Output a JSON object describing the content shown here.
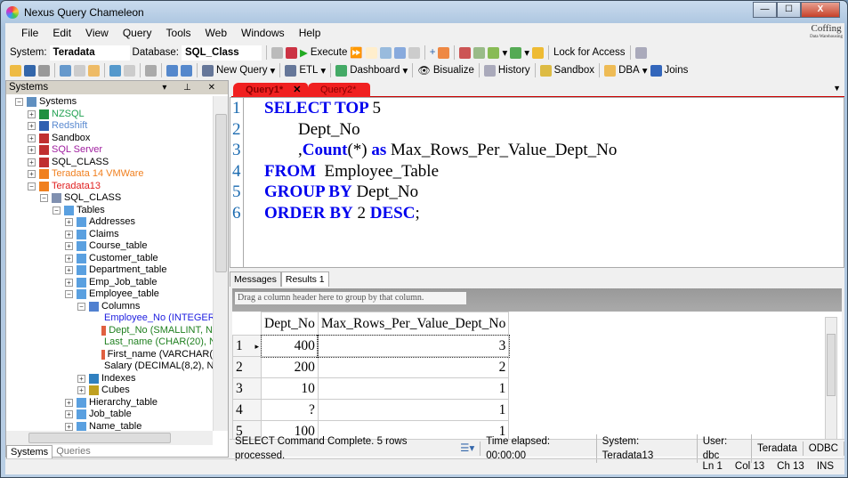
{
  "window": {
    "title": "Nexus Query Chameleon",
    "minimize": "—",
    "maximize": "☐",
    "close": "X",
    "brand": "Coffing",
    "brand_sub": "Data Warehousing"
  },
  "menu": [
    "File",
    "Edit",
    "View",
    "Query",
    "Tools",
    "Web",
    "Windows",
    "Help"
  ],
  "toolbar1": {
    "system_label": "System:",
    "system_value": "Teradata",
    "database_label": "Database:",
    "database_value": "SQL_Class",
    "execute": "Execute",
    "lock": "Lock for Access"
  },
  "toolbar2": {
    "new_query": "New Query",
    "etl": "ETL",
    "dashboard": "Dashboard",
    "bisualize": "Bisualize",
    "history": "History",
    "sandbox": "Sandbox",
    "dba": "DBA",
    "joins": "Joins"
  },
  "left_panel": {
    "title": "Systems",
    "tabs": [
      "Systems",
      "Queries"
    ],
    "tree": [
      {
        "label": "Systems",
        "depth": 0,
        "exp": "−",
        "color": "#000000",
        "icon": "servers-icon"
      },
      {
        "label": "NZSQL",
        "depth": 1,
        "exp": "+",
        "color": "#20a050",
        "icon": "nzsql-icon"
      },
      {
        "label": "Redshift",
        "depth": 1,
        "exp": "+",
        "color": "#5a8ad0",
        "icon": "redshift-icon"
      },
      {
        "label": "Sandbox",
        "depth": 1,
        "exp": "+",
        "color": "#000000",
        "icon": "sql-icon"
      },
      {
        "label": "SQL Server",
        "depth": 1,
        "exp": "+",
        "color": "#a020a0",
        "icon": "sql-icon"
      },
      {
        "label": "SQL_CLASS",
        "depth": 1,
        "exp": "+",
        "color": "#000000",
        "icon": "sql-icon"
      },
      {
        "label": "Teradata 14 VMWare",
        "depth": 1,
        "exp": "+",
        "color": "#f08020",
        "icon": "teradata-icon"
      },
      {
        "label": "Teradata13",
        "depth": 1,
        "exp": "−",
        "color": "#e02020",
        "icon": "teradata-icon"
      },
      {
        "label": "SQL_CLASS",
        "depth": 2,
        "exp": "−",
        "color": "#000000",
        "icon": "database-icon"
      },
      {
        "label": "Tables",
        "depth": 3,
        "exp": "−",
        "color": "#000000",
        "icon": "table-icon"
      },
      {
        "label": "Addresses",
        "depth": 4,
        "exp": "+",
        "color": "#000000",
        "icon": "table-icon"
      },
      {
        "label": "Claims",
        "depth": 4,
        "exp": "+",
        "color": "#000000",
        "icon": "table-icon"
      },
      {
        "label": "Course_table",
        "depth": 4,
        "exp": "+",
        "color": "#000000",
        "icon": "table-icon"
      },
      {
        "label": "Customer_table",
        "depth": 4,
        "exp": "+",
        "color": "#000000",
        "icon": "table-icon"
      },
      {
        "label": "Department_table",
        "depth": 4,
        "exp": "+",
        "color": "#000000",
        "icon": "table-icon"
      },
      {
        "label": "Emp_Job_table",
        "depth": 4,
        "exp": "+",
        "color": "#000000",
        "icon": "table-icon"
      },
      {
        "label": "Employee_table",
        "depth": 4,
        "exp": "−",
        "color": "#000000",
        "icon": "table-icon"
      },
      {
        "label": "Columns",
        "depth": 5,
        "exp": "−",
        "color": "#000000",
        "icon": "columns-icon"
      },
      {
        "label": "Employee_No (INTEGER",
        "depth": 6,
        "exp": "",
        "color": "#2020e0",
        "icon": "column-icon"
      },
      {
        "label": "Dept_No (SMALLINT, N",
        "depth": 6,
        "exp": "",
        "color": "#208020",
        "icon": "column-icon"
      },
      {
        "label": "Last_name (CHAR(20), N",
        "depth": 6,
        "exp": "",
        "color": "#208020",
        "icon": "column-icon"
      },
      {
        "label": "First_name (VARCHAR(",
        "depth": 6,
        "exp": "",
        "color": "#000000",
        "icon": "column-icon"
      },
      {
        "label": "Salary (DECIMAL(8,2), N",
        "depth": 6,
        "exp": "",
        "color": "#000000",
        "icon": "column-icon"
      },
      {
        "label": "Indexes",
        "depth": 5,
        "exp": "+",
        "color": "#000000",
        "icon": "indexes-icon"
      },
      {
        "label": "Cubes",
        "depth": 5,
        "exp": "+",
        "color": "#000000",
        "icon": "cubes-icon"
      },
      {
        "label": "Hierarchy_table",
        "depth": 4,
        "exp": "+",
        "color": "#000000",
        "icon": "table-icon"
      },
      {
        "label": "Job_table",
        "depth": 4,
        "exp": "+",
        "color": "#000000",
        "icon": "table-icon"
      },
      {
        "label": "Name_table",
        "depth": 4,
        "exp": "+",
        "color": "#000000",
        "icon": "table-icon"
      }
    ]
  },
  "editor": {
    "tabs": [
      "Query1*",
      "Query2*"
    ],
    "tab_close": "✕",
    "lines": [
      [
        {
          "t": "SELECT TOP ",
          "k": 1
        },
        {
          "t": "5",
          "k": 0
        }
      ],
      [
        {
          "t": "        Dept_No",
          "k": 0
        }
      ],
      [
        {
          "t": "        ,",
          "k": 0
        },
        {
          "t": "Count",
          "k": 1
        },
        {
          "t": "(*) ",
          "k": 0
        },
        {
          "t": "as",
          "k": 1
        },
        {
          "t": " Max_Rows_Per_Value_Dept_No",
          "k": 0
        }
      ],
      [
        {
          "t": "FROM",
          "k": 1
        },
        {
          "t": "  Employee_Table",
          "k": 0
        }
      ],
      [
        {
          "t": "GROUP BY",
          "k": 1
        },
        {
          "t": " Dept_No",
          "k": 0
        }
      ],
      [
        {
          "t": "ORDER BY",
          "k": 1
        },
        {
          "t": " 2 ",
          "k": 0
        },
        {
          "t": "DESC",
          "k": 1
        },
        {
          "t": ";",
          "k": 0
        }
      ]
    ]
  },
  "results": {
    "tabs": [
      "Messages",
      "Results 1"
    ],
    "group_hint": "Drag a column header here to group by that column.",
    "columns": [
      "Dept_No",
      "Max_Rows_Per_Value_Dept_No"
    ],
    "rows": [
      [
        "1",
        "400",
        "3"
      ],
      [
        "2",
        "200",
        "2"
      ],
      [
        "3",
        "10",
        "1"
      ],
      [
        "4",
        "?",
        "1"
      ],
      [
        "5",
        "100",
        "1"
      ]
    ]
  },
  "status": [
    "SELECT Command Complete.  5 rows processed.",
    "Time elapsed: 00:00:00",
    "System: Teradata13",
    "User: dbc",
    "Teradata",
    "ODBC"
  ],
  "bottom": [
    "Ln 1",
    "Col 13",
    "Ch 13",
    "INS"
  ]
}
